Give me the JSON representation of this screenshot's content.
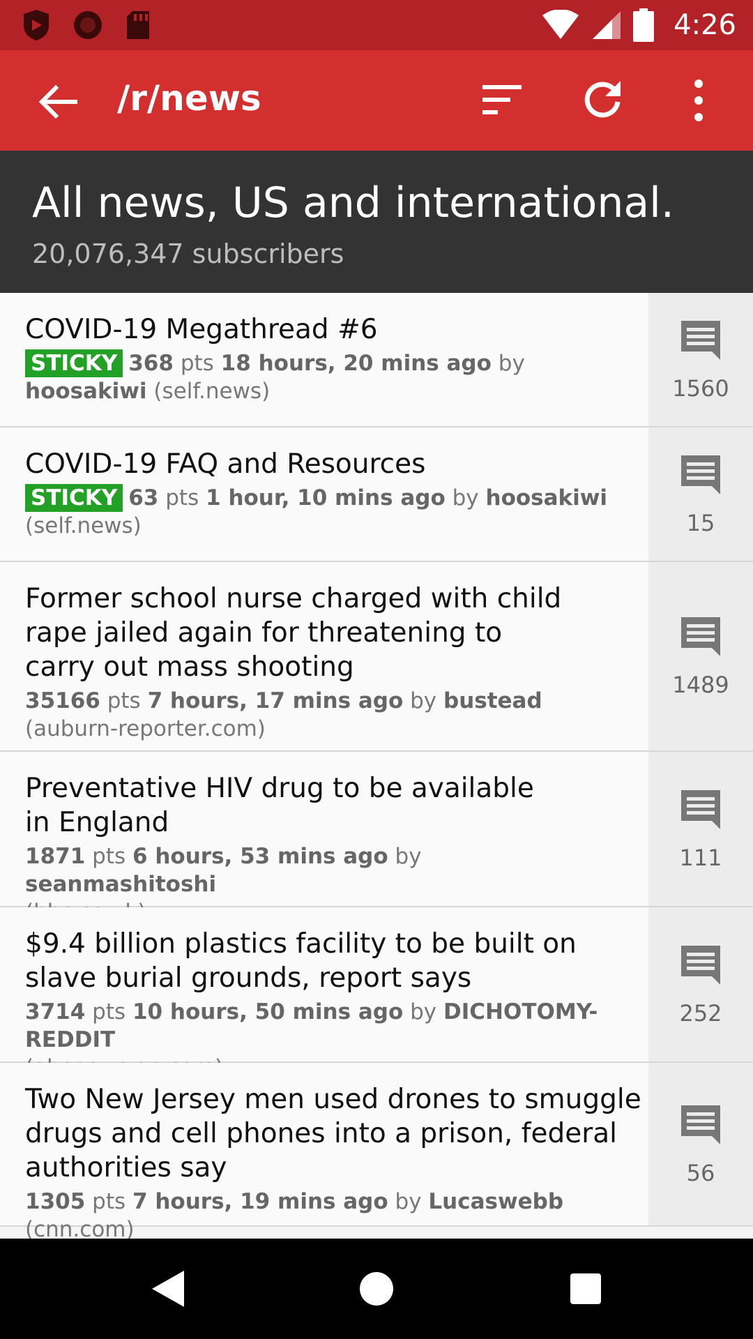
{
  "status_bar": {
    "time": "4:26",
    "icons": [
      "shield-icon",
      "record-icon",
      "sd-card-icon",
      "wifi-icon",
      "signal-icon",
      "battery-icon"
    ]
  },
  "toolbar": {
    "title": "/r/news",
    "icons": [
      "back-arrow-icon",
      "sort-icon",
      "refresh-icon",
      "more-vert-icon"
    ]
  },
  "subreddit": {
    "description": "All news, US and international.",
    "subscribers": "20,076,347 subscribers"
  },
  "colors": {
    "status_bar": "#b22227",
    "toolbar": "#d32f2f",
    "header": "#333333",
    "sticky": "#23a127"
  },
  "posts": [
    {
      "title": "COVID-19 Megathread #6",
      "sticky": "STICKY",
      "points": "368",
      "pts_label": "pts",
      "time": "18 hours, 20 mins ago",
      "by": "by",
      "author": "hoosakiwi",
      "domain": "(self.news)",
      "comments": "1560"
    },
    {
      "title": "COVID-19 FAQ and Resources",
      "sticky": "STICKY",
      "points": "63",
      "pts_label": "pts",
      "time": "1 hour, 10 mins ago",
      "by": "by",
      "author": "hoosakiwi",
      "domain": "(self.news)",
      "comments": "15"
    },
    {
      "title": "Former school nurse charged with child rape jailed again for threatening to carry out mass shooting",
      "points": "35166",
      "pts_label": "pts",
      "time": "7 hours, 17 mins ago",
      "by": "by",
      "author": "bustead",
      "domain": "(auburn-reporter.com)",
      "comments": "1489"
    },
    {
      "title": "Preventative HIV drug to be available in England",
      "points": "1871",
      "pts_label": "pts",
      "time": "6 hours, 53 mins ago",
      "by": "by",
      "author": "seanmashitoshi",
      "domain": "(bbc.co.uk)",
      "comments": "111"
    },
    {
      "title": "$9.4 billion plastics facility to be built on slave burial grounds, report says",
      "points": "3714",
      "pts_label": "pts",
      "time": "10 hours, 50 mins ago",
      "by": "by",
      "author": "DICHOTOMY-REDDIT",
      "domain": "(abcnews.go.com)",
      "comments": "252"
    },
    {
      "title": "Two New Jersey men used drones to smuggle drugs and cell phones into a prison, federal authorities say",
      "points": "1305",
      "pts_label": "pts",
      "time": "7 hours, 19 mins ago",
      "by": "by",
      "author": "Lucaswebb",
      "domain": "(cnn.com)",
      "comments": "56"
    }
  ],
  "nav_bar": {
    "icons": [
      "nav-back-icon",
      "nav-home-icon",
      "nav-recents-icon"
    ]
  }
}
